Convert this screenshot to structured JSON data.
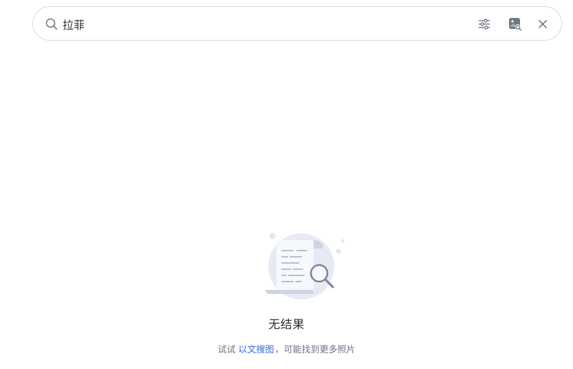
{
  "search": {
    "query": "拉菲",
    "icons": {
      "search": "search-icon",
      "filter": "sliders-icon",
      "image_search": "image-search-icon",
      "clear": "close-icon"
    }
  },
  "empty_state": {
    "illustration": "document-search-illustration",
    "title": "无结果",
    "hint_prefix": "试试",
    "hint_link": "以文搜图",
    "hint_suffix": "，可能找到更多照片"
  },
  "colors": {
    "border": "#d3d7de",
    "icon": "#6f7785",
    "link": "#2f6fdd",
    "illustration_bg": "#e6e9f3"
  }
}
